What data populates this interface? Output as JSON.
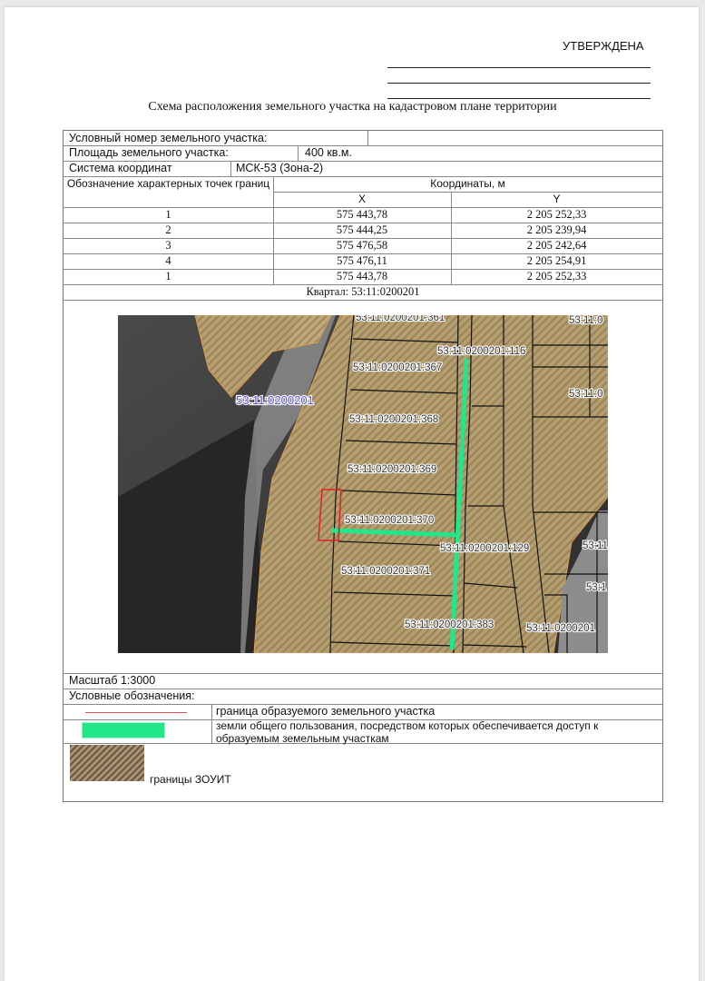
{
  "header": {
    "approved": "УТВЕРЖДЕНА",
    "title": "Схема расположения земельного участка на кадастровом плане территории"
  },
  "info": {
    "parcel_number_label": "Условный номер земельного участка:",
    "parcel_number_value": "",
    "area_label": "Площадь земельного участка:",
    "area_value": "400 кв.м.",
    "crs_label": "Система координат",
    "crs_value": "МСК-53 (Зона-2)"
  },
  "coords_table": {
    "point_header": "Обозначение характерных точек границ",
    "coords_header": "Координаты, м",
    "x_header": "X",
    "y_header": "Y",
    "rows": [
      {
        "point": "1",
        "x": "575 443,78",
        "y": "2 205 252,33"
      },
      {
        "point": "2",
        "x": "575 444,25",
        "y": "2 205 239,94"
      },
      {
        "point": "3",
        "x": "575 476,58",
        "y": "2 205 242,64"
      },
      {
        "point": "4",
        "x": "575 476,11",
        "y": "2 205 254,91"
      },
      {
        "point": "1",
        "x": "575 443,78",
        "y": "2 205 252,33"
      }
    ],
    "quarter": "Квартал: 53:11:0200201"
  },
  "map": {
    "labels": {
      "quarter": "53:11:0200201",
      "p116": "53:11:0200201:116",
      "p367": "53:11:0200201:367",
      "p368": "53:11:0200201:368",
      "p369": "53:11:0200201:369",
      "p370": "53:11:0200201:370",
      "p129": "53:11:0200201:129",
      "p371": "53:11:0200201:371",
      "p383": "53:11:0200201:383",
      "p361": "53:11:0200201:361",
      "right_a": "53:11:0",
      "right_b": "53:11:0",
      "right_c": "53:11",
      "right_d": "53:1",
      "right_e": "53:11:0200201"
    },
    "colors": {
      "zone_hatch": "#c9a35a",
      "parcel_border": "#e02020",
      "public_land": "#22e68a",
      "quarter_label": "#5a55e0"
    }
  },
  "footer": {
    "scale": "Масштаб 1:3000",
    "legend_title": "Условные обозначения:",
    "legend": [
      {
        "symbol": "red-line",
        "text": "граница образуемого земельного участка"
      },
      {
        "symbol": "green-bar",
        "text": "земли общего пользования, посредством которых обеспечивается доступ к образуемым земельным участкам"
      },
      {
        "symbol": "hatch-swatch",
        "text": "границы ЗОУИТ"
      }
    ]
  }
}
